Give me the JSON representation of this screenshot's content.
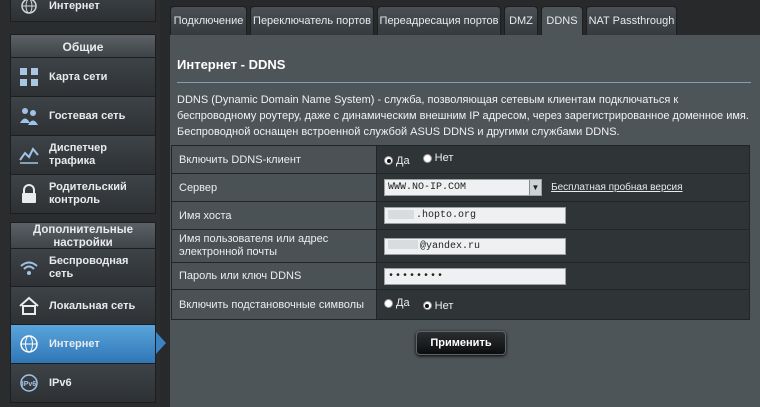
{
  "sidebar": {
    "top_item": "Интернет",
    "section_general": "Общие",
    "general_items": [
      {
        "label": "Карта сети",
        "icon": "network-map-icon"
      },
      {
        "label": "Гостевая сеть",
        "icon": "guest-network-icon"
      },
      {
        "label": "Диспетчер трафика",
        "icon": "traffic-manager-icon"
      },
      {
        "label": "Родительский контроль",
        "icon": "lock-icon"
      }
    ],
    "section_advanced": "Дополнительные настройки",
    "advanced_items": [
      {
        "label": "Беспроводная сеть",
        "icon": "wifi-icon"
      },
      {
        "label": "Локальная сеть",
        "icon": "home-icon"
      },
      {
        "label": "Интернет",
        "icon": "globe-icon",
        "active": true
      },
      {
        "label": "IPv6",
        "icon": "ipv6-icon"
      }
    ]
  },
  "tabs": [
    "Подключение",
    "Переключатель портов",
    "Переадресация портов",
    "DMZ",
    "DDNS",
    "NAT Passthrough"
  ],
  "active_tab": "DDNS",
  "page": {
    "title": "Интернет - DDNS",
    "description": "DDNS (Dynamic Domain Name System) - служба, позволяющая сетевым клиентам подключаться к беспроводному роутеру, даже с динамическим внешним IP адресом, через зарегистрированное доменное имя. Беспроводной оснащен встроенной службой ASUS DDNS и другими службами DDNS."
  },
  "form": {
    "enable_ddns": {
      "label": "Включить DDNS-клиент",
      "yes": "Да",
      "no": "Нет",
      "value": "Да"
    },
    "server": {
      "label": "Сервер",
      "value": "WWW.NO-IP.COM",
      "link": "Бесплатная пробная версия"
    },
    "hostname": {
      "label": "Имя хоста",
      "value": ".hopto.org"
    },
    "username": {
      "label": "Имя пользователя или адрес электронной почты",
      "value": "@yandex.ru"
    },
    "password": {
      "label": "Пароль или ключ DDNS",
      "value": "••••••••"
    },
    "wildcard": {
      "label": "Включить подстановочные символы",
      "yes": "Да",
      "no": "Нет",
      "value": "Нет"
    }
  },
  "apply_label": "Применить"
}
